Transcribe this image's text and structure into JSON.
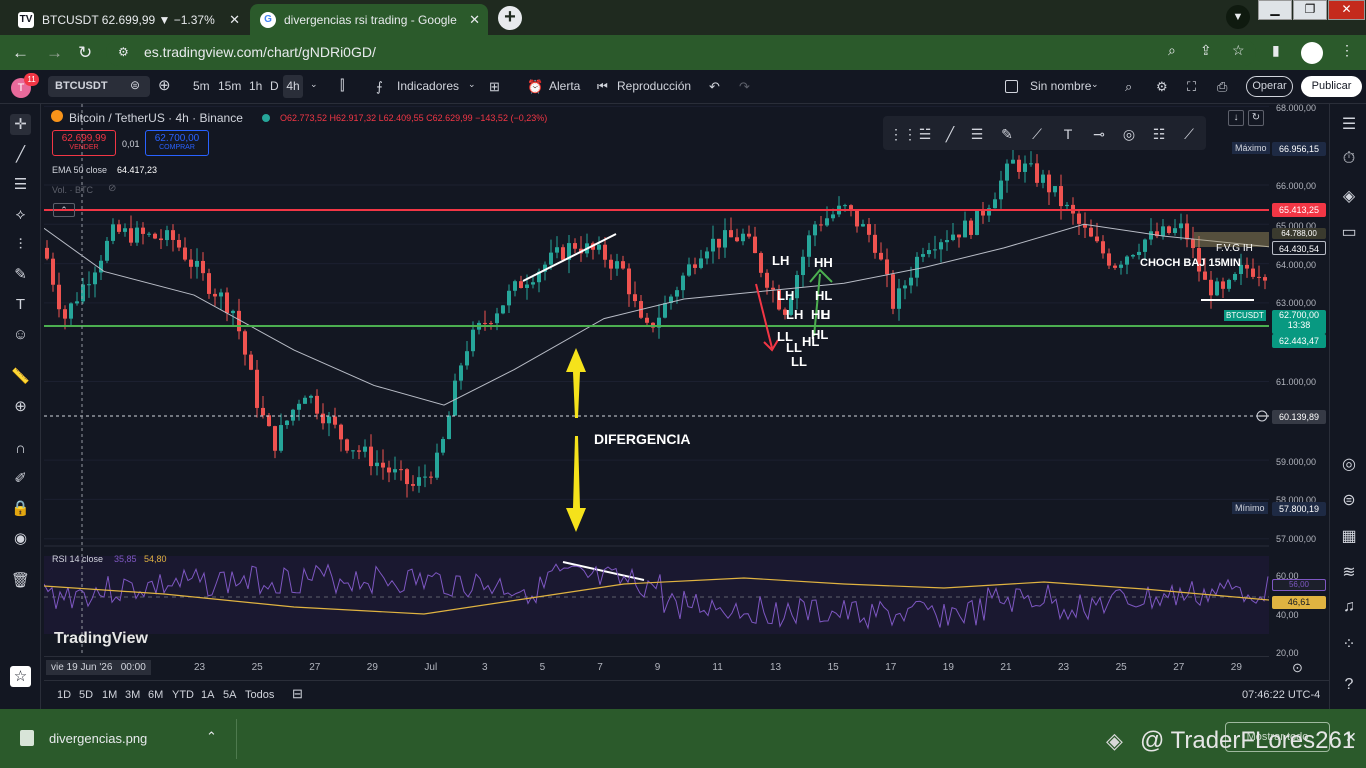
{
  "browser": {
    "tabs": [
      {
        "title": "BTCUSDT 62.699,99 ▼ −1.37% Si",
        "favicon": "TV",
        "active": false
      },
      {
        "title": "divergencias rsi trading - Google",
        "favicon": "G",
        "active": true
      }
    ],
    "url": "es.tradingview.com/chart/gNDRi0GD/"
  },
  "toolbar": {
    "avatar_badge": "11",
    "avatar_letter": "T",
    "symbol": "BTCUSDT",
    "intervals": [
      "5m",
      "15m",
      "1h",
      "D",
      "4h"
    ],
    "active_interval": "4h",
    "indicators_label": "Indicadores",
    "alert_label": "Alerta",
    "replay_label": "Reproducción",
    "layout_name": "Sin nombre",
    "trade_button": "Operar",
    "publish_button": "Publicar"
  },
  "legend": {
    "title": "Bitcoin / TetherUS · 4h · Binance",
    "ohlc": "O62.773,52 H62.917,32 L62.409,55 C62.629,99 −143,52 (−0,23%)",
    "sell_price": "62.699,99",
    "sell_label": "VENDER",
    "spread": "0,01",
    "buy_price": "62.700,00",
    "buy_label": "COMPRAR",
    "ema_label": "EMA 50 close",
    "ema_value": "64.417,23",
    "vol_label": "Vol. · BTC",
    "rsi_label": "RSI 14 close",
    "rsi_value1": "35,85",
    "rsi_value2": "54,80"
  },
  "annotations": {
    "divergence": "DIFERGENCIA",
    "lh1": "LH",
    "hh": "HH",
    "lh2": "LH",
    "hl1": "HL",
    "lh3": "LH",
    "hl2": "HL",
    "lh4": "H",
    "ll1": "LL",
    "hl3": "HL",
    "ll2": "LL",
    "ll3": "LL",
    "hl4": "HL",
    "choch": "CHOCH BAJ 15MIN",
    "fvg": "F.V.G IH"
  },
  "price_scale": {
    "labels": [
      "68.000,00",
      "66.000,00",
      "65.000,00",
      "64.000,00",
      "63.000,00",
      "61.000,00",
      "59.000,00",
      "58.000,00",
      "57.000,00"
    ],
    "max_label": "Máximo",
    "max_value": "66.956,15",
    "min_label": "Mínimo",
    "min_value": "57.800,19",
    "red_level": "65.413,25",
    "fvg_top": "64.788,00",
    "ema_tag": "64.430,54",
    "symbol_tag": "BTCUSDT",
    "last_price": "62.700,00",
    "countdown": "13:38",
    "green_level": "62.443,47",
    "crosshair_price": "60.139,89",
    "rsi_labels": [
      "60,00",
      "40,00",
      "20,00"
    ],
    "rsi_tag1": "56,00",
    "rsi_tag2": "46,61"
  },
  "time_scale": {
    "current": "vie 19 Jun '26",
    "current_time": "00:00",
    "ticks": [
      "23",
      "25",
      "27",
      "29",
      "Jul",
      "3",
      "5",
      "7",
      "9",
      "11",
      "13",
      "15",
      "17",
      "19",
      "21",
      "23",
      "25",
      "27",
      "29"
    ]
  },
  "bottom": {
    "ranges": [
      "1D",
      "5D",
      "1M",
      "3M",
      "6M",
      "YTD",
      "1A",
      "5A",
      "Todos"
    ],
    "clock": "07:46:22 UTC-4"
  },
  "watermark": "TradingView",
  "download": {
    "filename": "divergencias.png",
    "show_all": "Mostrar todo",
    "credit": "@ TraderFLores261"
  },
  "colors": {
    "up": "#26a69a",
    "down": "#ef5350",
    "ema": "#b8bcc6",
    "rsi": "#7e57c2",
    "rsi_ma": "#e0b341",
    "red_line": "#f23645",
    "green_line": "#4caf50",
    "arrow": "#f5e21b"
  }
}
